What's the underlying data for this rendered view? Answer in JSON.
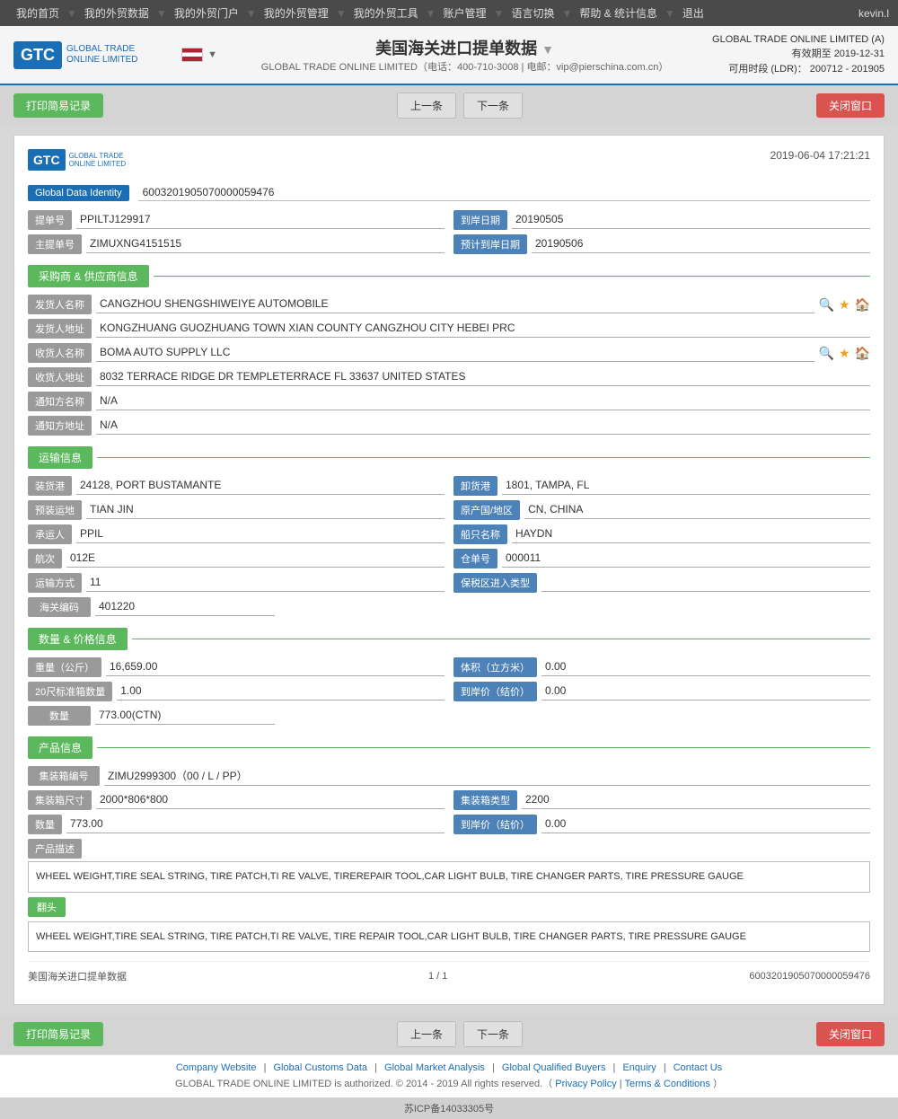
{
  "nav": {
    "items": [
      {
        "label": "我的首页",
        "id": "home"
      },
      {
        "label": "我的外贸数据",
        "id": "trade-data"
      },
      {
        "label": "我的外贸门户",
        "id": "portal"
      },
      {
        "label": "我的外贸管理",
        "id": "management"
      },
      {
        "label": "我的外贸工具",
        "id": "tools"
      },
      {
        "label": "账户管理",
        "id": "account"
      },
      {
        "label": "语言切换",
        "id": "language"
      },
      {
        "label": "帮助 & 统计信息",
        "id": "help"
      },
      {
        "label": "退出",
        "id": "logout"
      }
    ],
    "user": "kevin.l"
  },
  "header": {
    "title": "美国海关进口提单数据",
    "subtitle": "GLOBAL TRADE ONLINE LIMITED（电话：400-710-3008 | 电邮：vip@pierschina.com.cn）",
    "company": "GLOBAL TRADE ONLINE LIMITED (A)",
    "expiry_label": "有效期至",
    "expiry": "2019-12-31",
    "ldr_label": "可用时段 (LDR)：",
    "ldr": "200712 - 201905"
  },
  "toolbar": {
    "print_btn": "打印简易记录",
    "prev_btn": "上一条",
    "next_btn": "下一条",
    "close_btn": "关闭窗口"
  },
  "document": {
    "date": "2019-06-04 17:21:21",
    "gdi_label": "Global Data Identity",
    "gdi_value": "6003201905070000059476",
    "bill_no_label": "提单号",
    "bill_no": "PPILTJ129917",
    "arrival_date_label": "到岸日期",
    "arrival_date": "20190505",
    "master_bill_label": "主提单号",
    "master_bill": "ZIMUXNG4151515",
    "est_arrival_label": "预计到岸日期",
    "est_arrival": "20190506"
  },
  "supplier": {
    "section_title": "采购商 & 供应商信息",
    "shipper_name_label": "发货人名称",
    "shipper_name": "CANGZHOU SHENGSHIWEIYE AUTOMOBILE",
    "shipper_addr_label": "发货人地址",
    "shipper_addr": "KONGZHUANG GUOZHUANG TOWN XIAN COUNTY CANGZHOU CITY HEBEI PRC",
    "consignee_name_label": "收货人名称",
    "consignee_name": "BOMA AUTO SUPPLY LLC",
    "consignee_addr_label": "收货人地址",
    "consignee_addr": "8032 TERRACE RIDGE DR TEMPLETERRACE FL 33637 UNITED STATES",
    "notify_name_label": "通知方名称",
    "notify_name": "N/A",
    "notify_addr_label": "通知方地址",
    "notify_addr": "N/A"
  },
  "transport": {
    "section_title": "运输信息",
    "load_port_label": "装货港",
    "load_port": "24128, PORT BUSTAMANTE",
    "discharge_port_label": "卸货港",
    "discharge_port": "1801, TAMPA, FL",
    "pre_transport_label": "预装运地",
    "pre_transport": "TIAN JIN",
    "origin_label": "原产国/地区",
    "origin": "CN, CHINA",
    "carrier_label": "承运人",
    "carrier": "PPIL",
    "vessel_label": "船只名称",
    "vessel": "HAYDN",
    "voyage_label": "航次",
    "voyage": "012E",
    "manifest_label": "仓单号",
    "manifest": "000011",
    "transport_mode_label": "运输方式",
    "transport_mode": "11",
    "bonded_label": "保税区进入类型",
    "bonded": "",
    "customs_code_label": "海关编码",
    "customs_code": "401220"
  },
  "quantity": {
    "section_title": "数量 & 价格信息",
    "weight_label": "重量（公斤）",
    "weight": "16,659.00",
    "volume_label": "体积（立方米）",
    "volume": "0.00",
    "containers_20_label": "20尺标准箱数量",
    "containers_20": "1.00",
    "arrival_price_label": "到岸价（结价）",
    "arrival_price": "0.00",
    "quantity_label": "数量",
    "quantity": "773.00(CTN)"
  },
  "product": {
    "section_title": "产品信息",
    "container_no_label": "集装箱编号",
    "container_no": "ZIMU2999300（00 / L / PP）",
    "container_size_label": "集装箱尺寸",
    "container_size": "2000*806*800",
    "container_type_label": "集装箱类型",
    "container_type": "2200",
    "quantity_label": "数量",
    "quantity": "773.00",
    "arrival_price_label": "到岸价（结价）",
    "arrival_price": "0.00",
    "desc_label": "产品描述",
    "desc": "WHEEL WEIGHT,TIRE SEAL STRING, TIRE PATCH,TI RE VALVE, TIREREPAIR TOOL,CAR LIGHT BULB, TIRE CHANGER PARTS, TIRE PRESSURE GAUGE",
    "translate_btn": "翻头",
    "translated_desc": "WHEEL WEIGHT,TIRE SEAL STRING, TIRE PATCH,TI RE VALVE, TIRE REPAIR TOOL,CAR LIGHT BULB, TIRE CHANGER PARTS, TIRE PRESSURE GAUGE"
  },
  "doc_footer": {
    "source": "美国海关进口提单数据",
    "page": "1 / 1",
    "record_id": "6003201905070000059476"
  },
  "site_footer": {
    "company_website": "Company Website",
    "global_customs": "Global Customs Data",
    "global_market": "Global Market Analysis",
    "global_qualified": "Global Qualified Buyers",
    "enquiry": "Enquiry",
    "contact": "Contact Us",
    "copyright": "GLOBAL TRADE ONLINE LIMITED is authorized. © 2014 - 2019 All rights reserved.（",
    "privacy": "Privacy Policy",
    "terms": "Terms & Conditions",
    "closing": "）",
    "icp": "苏ICP备14033305号"
  }
}
